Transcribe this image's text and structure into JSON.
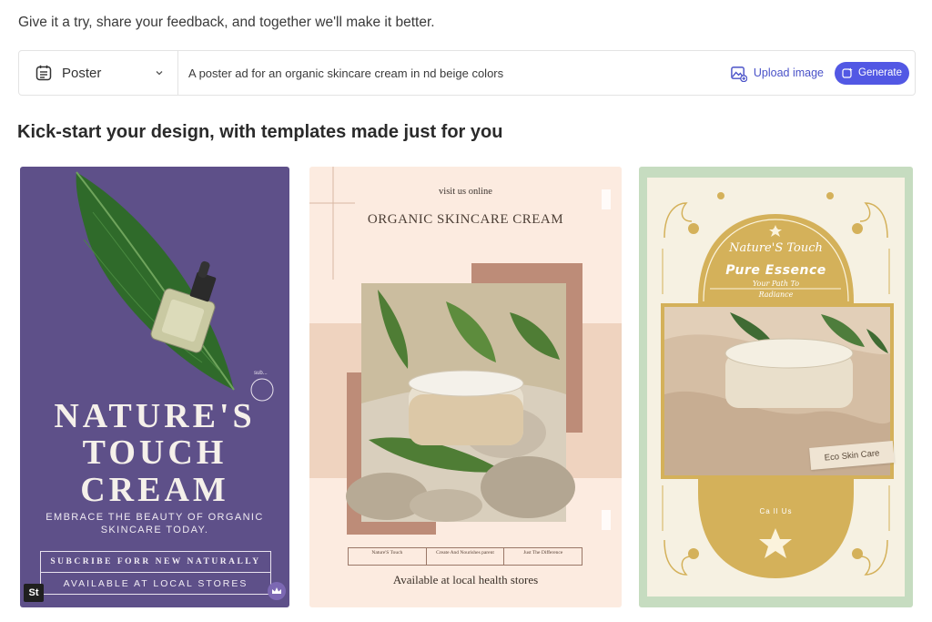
{
  "intro": "Give it a try, share your feedback, and together we'll make it better.",
  "prompt_bar": {
    "type_label": "Poster",
    "prompt_text": "A poster ad for an organic skincare cream in nd beige colors",
    "upload_label": "Upload image",
    "generate_label": "Generate"
  },
  "section_title": "Kick-start your design, with templates made just for you",
  "templates": [
    {
      "title_lines": [
        "NATURE'S",
        "TOUCH",
        "CREAM"
      ],
      "subtitle": "EMBRACE THE BEAUTY OF ORGANIC SKINCARE TODAY.",
      "box_line1": "SUBCRIBE FORR NEW NATURALLY",
      "box_line2": "AVAILABLE AT LOCAL STORES",
      "badge": "St",
      "small_text": "sub..."
    },
    {
      "visit": "visit us online",
      "title": "ORGANIC SKINCARE CREAM",
      "table": [
        "Nature'S Touch",
        "Create And Nourishes parent",
        "Just The Difference"
      ],
      "footer": "Available at local health stores"
    },
    {
      "brand": "Nature'S Touch",
      "headline": "Pure Essence",
      "tagline1": "Your Path To",
      "tagline2": "Radiance",
      "eco": "Eco Skin Care",
      "call": "Ca ll Us"
    }
  ],
  "colors": {
    "accent": "#5258e4",
    "card1_bg": "#5e5089",
    "card2_bg": "#fcebe0",
    "card3_bg": "#c6dcc0",
    "gold": "#d4b15a"
  }
}
